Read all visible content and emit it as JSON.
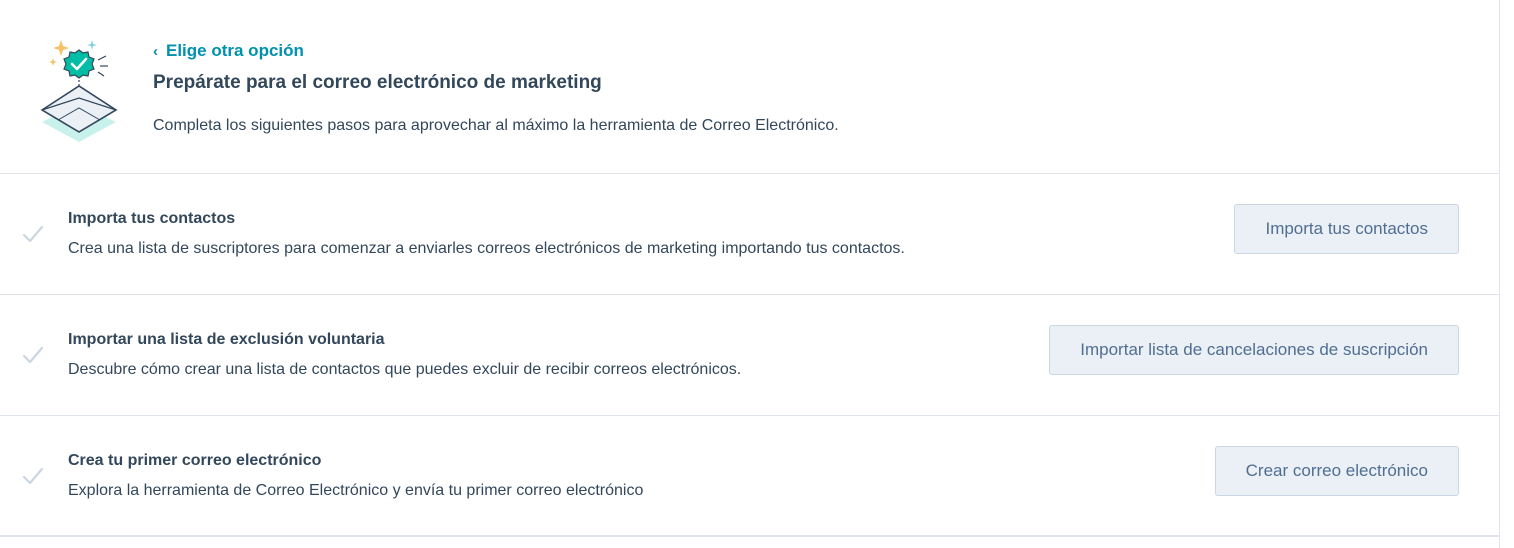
{
  "header": {
    "back_label": "Elige otra opción",
    "title": "Prepárate para el correo electrónico de marketing",
    "subtitle": "Completa los siguientes pasos para aprovechar al máximo la herramienta de Correo Electrónico."
  },
  "steps": [
    {
      "title": "Importa tus contactos",
      "description": "Crea una lista de suscriptores para comenzar a enviarles correos electrónicos de marketing importando tus contactos.",
      "button_label": "Importa tus contactos",
      "check_icon": "check-icon"
    },
    {
      "title": "Importar una lista de exclusión voluntaria",
      "description": "Descubre cómo crear una lista de contactos que puedes excluir de recibir correos electrónicos.",
      "button_label": "Importar lista de cancelaciones de suscripción",
      "check_icon": "check-icon"
    },
    {
      "title": "Crea tu primer correo electrónico",
      "description": "Explora la herramienta de Correo Electrónico y envía tu primer correo electrónico",
      "button_label": "Crear correo electrónico",
      "check_icon": "check-icon"
    }
  ],
  "colors": {
    "link": "#0091ae",
    "text": "#33475b",
    "button_bg": "#eaf0f6",
    "button_text": "#506e91",
    "divider": "#dfe3eb",
    "badge": "#00bda5"
  }
}
